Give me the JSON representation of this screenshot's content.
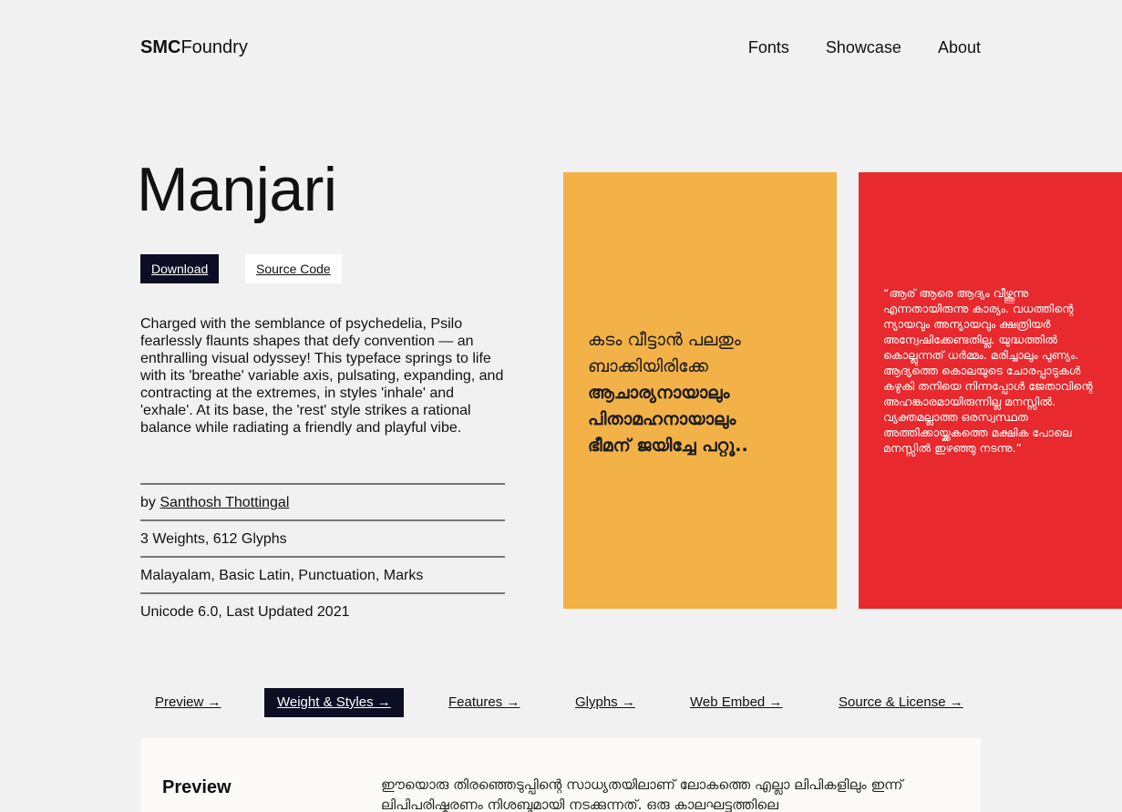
{
  "header": {
    "logo_bold": "SMC",
    "logo_regular": "Foundry",
    "nav": [
      "Fonts",
      "Showcase",
      "About"
    ]
  },
  "hero": {
    "title": "Manjari",
    "download_label": "Download",
    "source_label": "Source Code",
    "description": "Charged with the semblance of psychedelia, Psilo fearlessly flaunts shapes that defy convention — an enthralling visual odyssey! This typeface springs to life with its 'breathe' variable axis, pulsating, expanding, and contracting at the extremes, in styles 'inhale' and 'exhale'. At its base, the 'rest' style strikes a rational balance while radiating a friendly and playful vibe.",
    "meta": {
      "by_prefix": "by ",
      "author": "Santhosh Thottingal",
      "weights": "3 Weights, 612 Glyphs",
      "scripts": "Malayalam, Basic Latin, Punctuation, Marks",
      "unicode": "Unicode 6.0, Last Updated 2021"
    }
  },
  "cards": {
    "yellow": {
      "light_lines": [
        "കടം വീട്ടാൻ പലതും",
        "ബാക്കിയിരിക്കേ"
      ],
      "bold_lines": [
        "ആചാര്യനായാലും",
        "പിതാമഹനായാലും",
        "ഭീമന് ജയിച്ചേ പറ്റൂ.."
      ],
      "color": "#f2b247"
    },
    "red": {
      "quote": "“ആര് ആരെ ആദ്യം വീഴ്ത്തുന്നു എന്നതായിരുന്നു കാര്യം. വധത്തിന്റെ ന്യായവും അന്യായവും ക്ഷത്രിയർ അന്വേഷിക്കേണ്ടതില്ല. യുദ്ധത്തിൽ കൊല്ലുന്നത് ധർമ്മം. മരിച്ചാലും പുണ്യം. ആദ്യത്തെ കൊലയുടെ ചോരപ്പാടുകൾ കഴുകി തനിയെ നിന്നപ്പോൾ ജേതാവിന്റെ അഹങ്കാരമായിരുന്നില്ല മനസ്സിൽ. വ്യക്തമല്ലാത്ത ഒരസ്വസ്ഥത അത്തിക്കായ്ക്കകത്തെ മക്ഷിക പോലെ മനസ്സിൽ ഇഴഞ്ഞു നടന്നു.”",
      "color": "#e8292e"
    }
  },
  "tabs": [
    {
      "label": "Preview →"
    },
    {
      "label": "Weight & Styles →"
    },
    {
      "label": "Features →"
    },
    {
      "label": "Glyphs →"
    },
    {
      "label": "Web Embed →"
    },
    {
      "label": "Source & License →"
    }
  ],
  "active_tab": "Weight & Styles →",
  "preview": {
    "title": "Preview",
    "text": "ഈയൊരു തിരഞ്ഞെടുപ്പിന്റെ സാധ്യതയിലാണ് ലോകത്തെ എല്ലാ ലിപികളിലും ഇന്ന് ലിപിപരിഷ്കരണം നിശബ്ദമായി നടക്കുന്നത്. ഒരു കാലഘട്ടത്തിലെ"
  }
}
